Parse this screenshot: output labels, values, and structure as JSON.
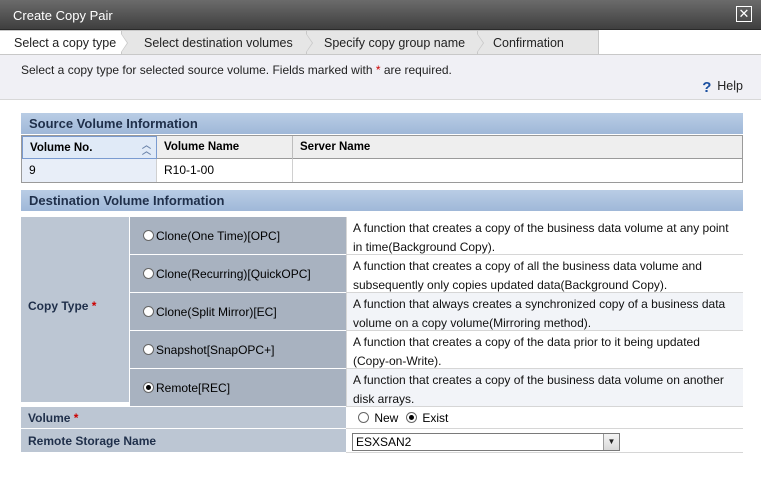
{
  "dialog": {
    "title": "Create Copy Pair",
    "close_symbol": "✕"
  },
  "steps": [
    {
      "label": "Select a copy type",
      "active": true
    },
    {
      "label": "Select destination volumes",
      "active": false
    },
    {
      "label": "Specify copy group name",
      "active": false
    },
    {
      "label": "Confirmation",
      "active": false
    }
  ],
  "instructions": {
    "text_before": "Select a copy type for selected source volume. Fields marked with ",
    "required_mark": "*",
    "text_after": " are required.",
    "help_label": "Help"
  },
  "source": {
    "heading": "Source Volume Information",
    "columns": [
      "Volume No.",
      "Volume Name",
      "Server Name"
    ],
    "row": [
      "9",
      "R10-1-00",
      ""
    ]
  },
  "destination": {
    "heading": "Destination Volume Information",
    "copy_type_label": "Copy Type",
    "required_mark": "*",
    "options": [
      {
        "label": "Clone(One Time)[OPC]",
        "selected": false,
        "description": "A function that creates a copy of the business data volume at any point in time(Background Copy)."
      },
      {
        "label": "Clone(Recurring)[QuickOPC]",
        "selected": false,
        "description": "A function that creates a copy of all the business data volume and subsequently only copies updated data(Background Copy)."
      },
      {
        "label": "Clone(Split Mirror)[EC]",
        "selected": false,
        "description": "A function that always creates a synchronized copy of a business data volume on a copy volume(Mirroring method)."
      },
      {
        "label": "Snapshot[SnapOPC+]",
        "selected": false,
        "description": "A function that creates a copy of the data prior to it being updated (Copy-on-Write)."
      },
      {
        "label": "Remote[REC]",
        "selected": true,
        "description": "A function that creates a copy of the business data volume on another disk arrays."
      }
    ],
    "volume_label": "Volume",
    "volume_options": [
      {
        "label": "New",
        "selected": false
      },
      {
        "label": "Exist",
        "selected": true
      }
    ],
    "remote_storage_label": "Remote Storage Name",
    "remote_storage_value": "ESXSAN2"
  },
  "colors": {
    "title_bar": "#4f4f4f",
    "section_header": "#a9c0dd",
    "label_cell": "#bcc6d3",
    "required": "#cc0000"
  }
}
